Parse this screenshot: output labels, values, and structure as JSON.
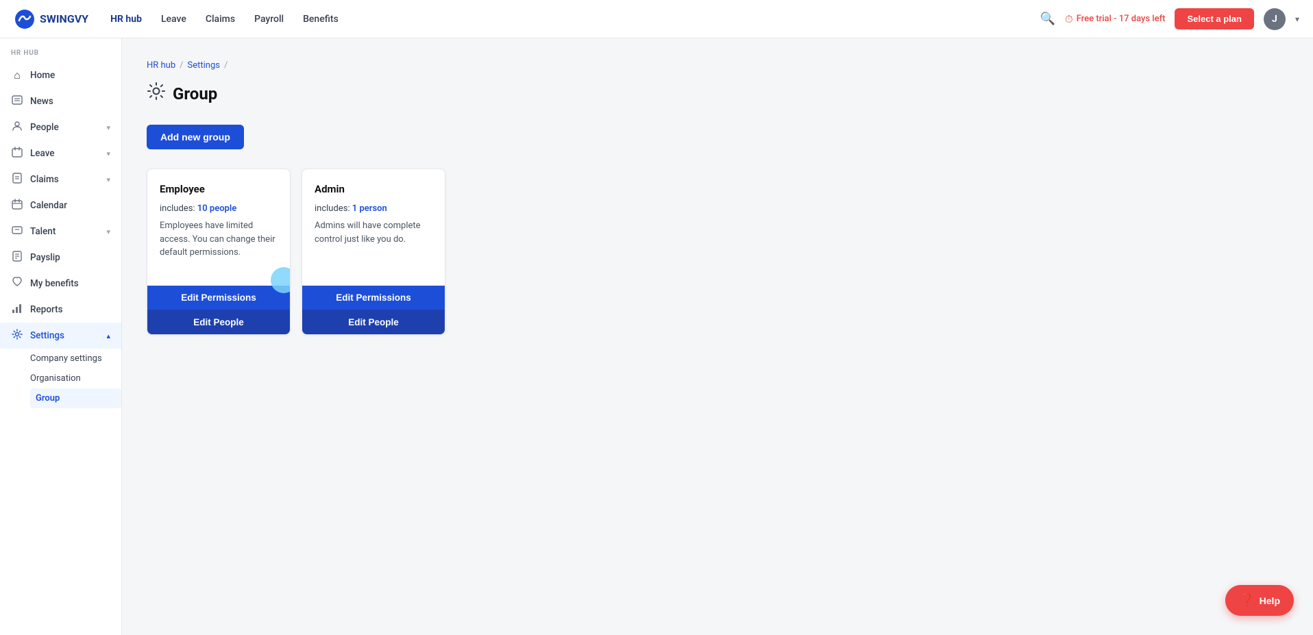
{
  "logo": {
    "text": "SWINGVY"
  },
  "topnav": {
    "links": [
      {
        "label": "HR hub",
        "active": true
      },
      {
        "label": "Leave",
        "active": false
      },
      {
        "label": "Claims",
        "active": false
      },
      {
        "label": "Payroll",
        "active": false
      },
      {
        "label": "Benefits",
        "active": false
      }
    ],
    "free_trial": "Free trial - 17 days left",
    "select_plan": "Select a plan",
    "avatar_initial": "J"
  },
  "sidebar": {
    "section_label": "HR HUB",
    "items": [
      {
        "id": "home",
        "label": "Home",
        "icon": "⌂",
        "has_chevron": false,
        "active": false
      },
      {
        "id": "news",
        "label": "News",
        "icon": "◻",
        "has_chevron": false,
        "active": false
      },
      {
        "id": "people",
        "label": "People",
        "icon": "👤",
        "has_chevron": true,
        "active": false
      },
      {
        "id": "leave",
        "label": "Leave",
        "icon": "🗃",
        "has_chevron": true,
        "active": false
      },
      {
        "id": "claims",
        "label": "Claims",
        "icon": "◻",
        "has_chevron": true,
        "active": false
      },
      {
        "id": "calendar",
        "label": "Calendar",
        "icon": "📅",
        "has_chevron": false,
        "active": false
      },
      {
        "id": "talent",
        "label": "Talent",
        "icon": "◻",
        "has_chevron": true,
        "active": false
      },
      {
        "id": "payslip",
        "label": "Payslip",
        "icon": "💳",
        "has_chevron": false,
        "active": false
      },
      {
        "id": "my-benefits",
        "label": "My benefits",
        "icon": "♡",
        "has_chevron": false,
        "active": false
      },
      {
        "id": "reports",
        "label": "Reports",
        "icon": "📊",
        "has_chevron": false,
        "active": false
      },
      {
        "id": "settings",
        "label": "Settings",
        "icon": "⚙",
        "has_chevron": true,
        "active": true
      }
    ],
    "settings_sub": [
      {
        "id": "company-settings",
        "label": "Company settings",
        "active": false
      },
      {
        "id": "organisation",
        "label": "Organisation",
        "active": false
      },
      {
        "id": "group",
        "label": "Group",
        "active": true
      }
    ]
  },
  "breadcrumb": {
    "items": [
      "HR hub",
      "Settings"
    ],
    "separators": [
      "/",
      "/"
    ]
  },
  "page": {
    "title": "Group",
    "add_button": "Add new group"
  },
  "cards": [
    {
      "id": "employee",
      "title": "Employee",
      "includes_label": "includes:",
      "includes_count": "10 people",
      "description": "Employees have limited access. You can change their default permissions.",
      "edit_permissions_label": "Edit Permissions",
      "edit_people_label": "Edit People"
    },
    {
      "id": "admin",
      "title": "Admin",
      "includes_label": "includes:",
      "includes_count": "1 person",
      "description": "Admins will have complete control just like you do.",
      "edit_permissions_label": "Edit Permissions",
      "edit_people_label": "Edit People"
    }
  ],
  "help": {
    "label": "Help"
  }
}
